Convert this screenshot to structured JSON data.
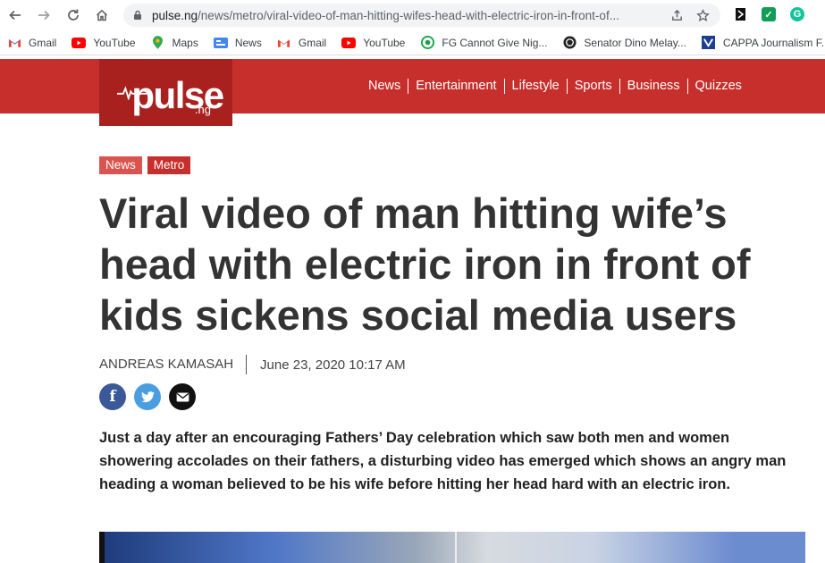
{
  "browser": {
    "url_host": "pulse.ng",
    "url_path": "/news/metro/viral-video-of-man-hitting-wifes-head-with-electric-iron-in-front-of...",
    "bookmarks": [
      {
        "label": "Gmail",
        "icon": "gmail-icon"
      },
      {
        "label": "YouTube",
        "icon": "youtube-icon"
      },
      {
        "label": "Maps",
        "icon": "maps-icon"
      },
      {
        "label": "News",
        "icon": "google-news-icon"
      },
      {
        "label": "Gmail",
        "icon": "gmail-icon"
      },
      {
        "label": "YouTube",
        "icon": "youtube-icon"
      },
      {
        "label": "FG Cannot Give Nig...",
        "icon": "grammarly-icon"
      },
      {
        "label": "Senator Dino Melay...",
        "icon": "site-icon"
      },
      {
        "label": "CAPPA Journalism F...",
        "icon": "bookmark-site-icon"
      }
    ]
  },
  "site": {
    "logo_word": "pulse",
    "logo_tld": ".ng",
    "nav": [
      "News",
      "Entertainment",
      "Lifestyle",
      "Sports",
      "Business",
      "Quizzes"
    ],
    "brand_color": "#c62f2c"
  },
  "article": {
    "tags": [
      "News",
      "Metro"
    ],
    "headline": "Viral video of man hitting wife’s head with electric iron in front of kids sickens social media users",
    "author": "ANDREAS KAMASAH",
    "date": "June 23, 2020 10:17 AM",
    "share": [
      {
        "name": "facebook",
        "glyph": "f"
      },
      {
        "name": "twitter",
        "glyph": "t"
      },
      {
        "name": "email",
        "glyph": "✉"
      }
    ],
    "lede": "Just a day after an encouraging Fathers’ Day celebration which saw both men and women showering accolades on their fathers, a disturbing video has emerged which shows an angry man heading a woman believed to be his wife before hitting her head hard with an electric iron."
  }
}
